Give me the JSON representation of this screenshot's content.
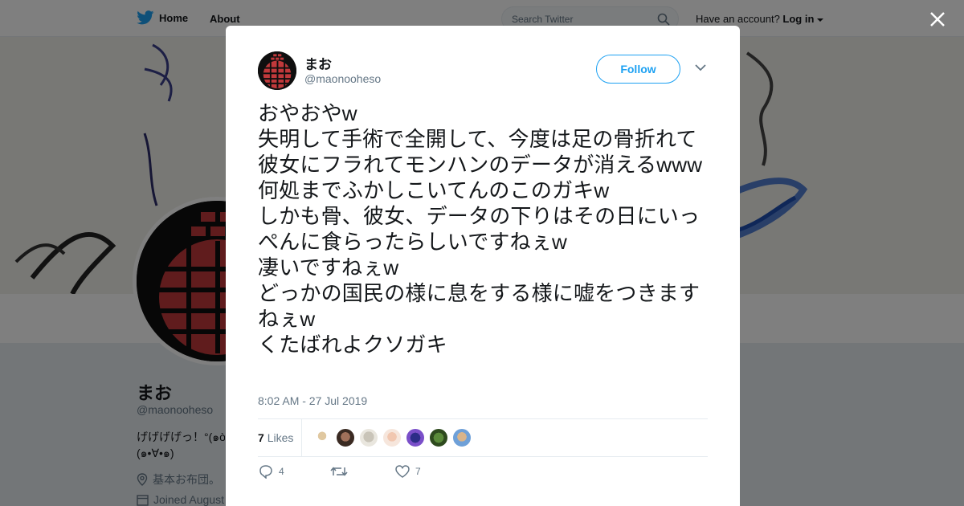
{
  "nav": {
    "home_label": "Home",
    "about_label": "About",
    "search_placeholder": "Search Twitter",
    "have_account": "Have an account?",
    "login_label": "Log in"
  },
  "profile": {
    "name": "まお",
    "handle": "@maonooheso",
    "bio": "げげげげっ！°(๑ò\n(๑•∀•๑)",
    "location": "基本お布団。",
    "joined": "Joined August"
  },
  "tweet": {
    "author_name": "まお",
    "author_handle": "@maonooheso",
    "follow_label": "Follow",
    "text": "おやおやw\n失明して手術で全開して、今度は足の骨折れて彼女にフラれてモンハンのデータが消えるwww\n何処までふかしこいてんのこのガキw\nしかも骨、彼女、データの下りはその日にいっぺんに食らったらしいですねぇw\n凄いですねぇw\nどっかの国民の様に息をする様に嘘をつきますねぇw\nくたばれよクソガキ",
    "timestamp": "8:02 AM - 27 Jul 2019",
    "likes_count": "7",
    "likes_label": "Likes",
    "reply_count": "4",
    "retweet_count": "",
    "like_count": "7"
  },
  "colors": {
    "accent": "#1da1f2",
    "avatar_red": "#c0393b"
  },
  "icons": [
    "twitter-bird-icon",
    "search-icon",
    "close-icon",
    "chevron-down-icon",
    "reply-icon",
    "retweet-icon",
    "heart-icon",
    "location-icon",
    "calendar-icon"
  ]
}
